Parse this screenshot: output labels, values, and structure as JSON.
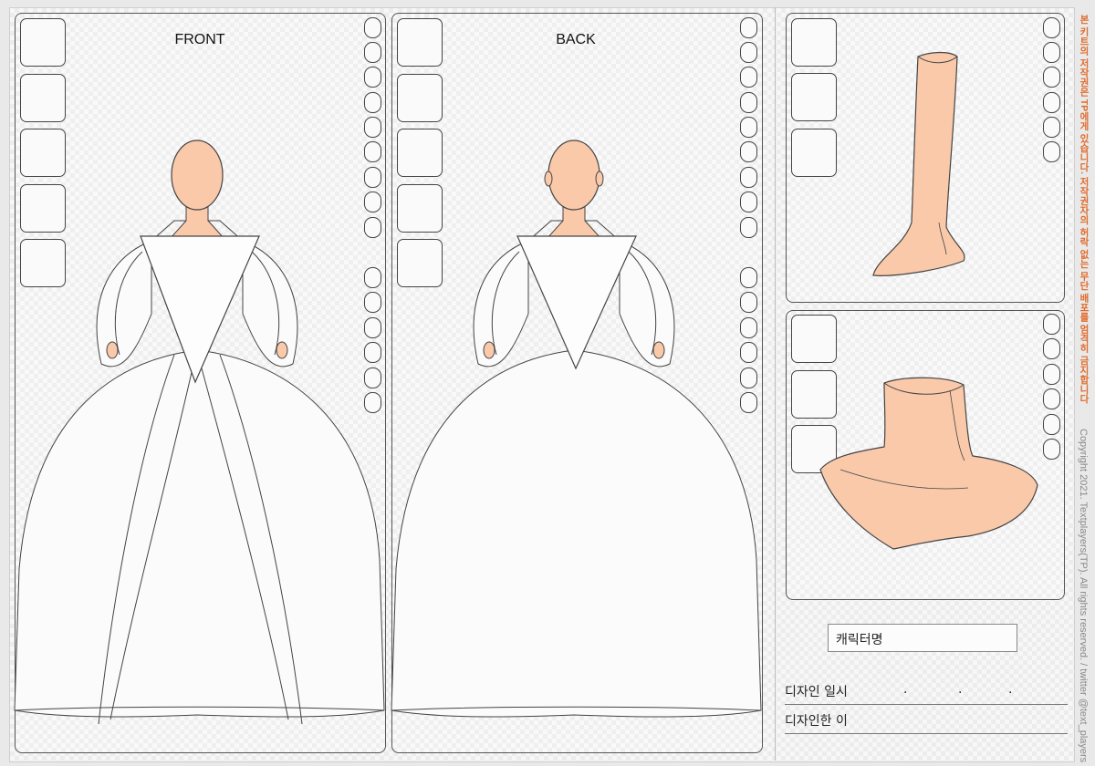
{
  "views": {
    "front_label": "FRONT",
    "back_label": "BACK"
  },
  "form": {
    "character_name_placeholder": "캐릭터명",
    "design_date_label": "디자인 일시",
    "date_separators": [
      ".",
      ".",
      "."
    ],
    "designer_label": "디자인한 이"
  },
  "side": {
    "warning": "본 키트의 저작권은 TP에게 있습니다. 저작권자의 허락 없는 무단 배포를 엄격히 금지합니다",
    "copyright": "Copyright 2021. Textplayers(TP). All rights reserved.  / twitter @text_players"
  },
  "colors": {
    "skin": "#f9c9aa",
    "warning": "#e06a2a",
    "outline": "#444444"
  }
}
